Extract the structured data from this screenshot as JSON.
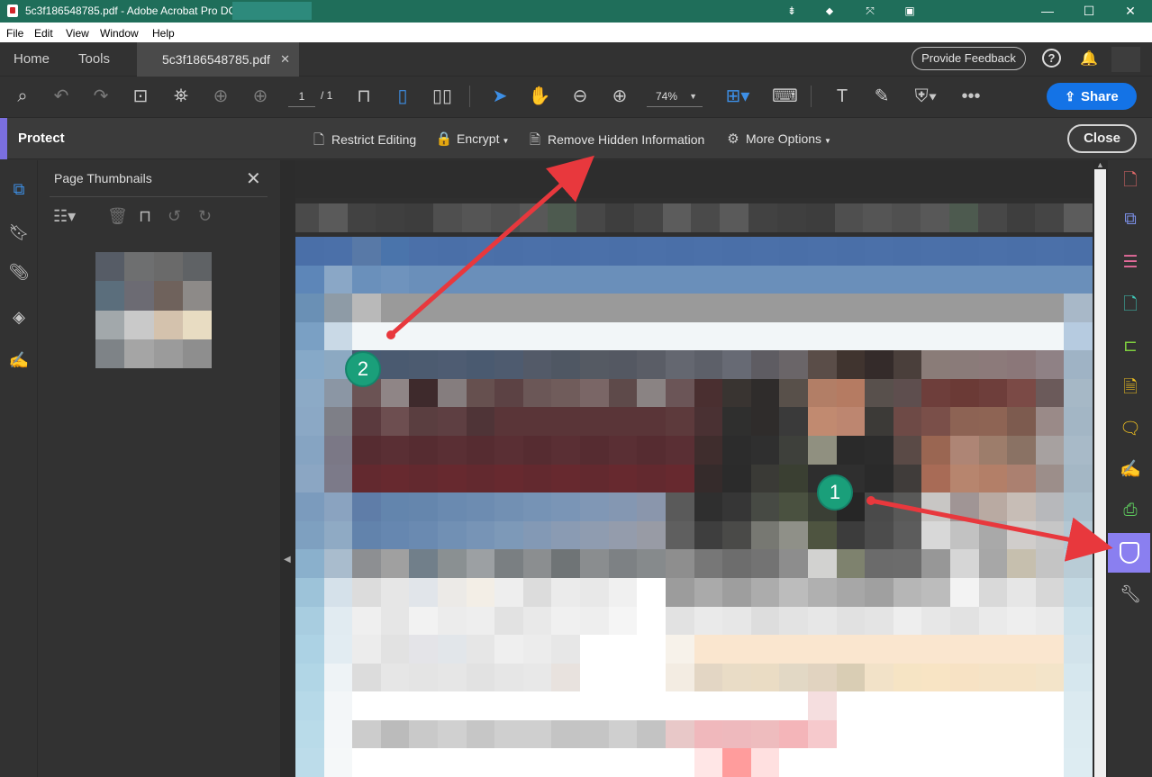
{
  "window": {
    "title": "5c3f186548785.pdf - Adobe Acrobat Pro DC"
  },
  "menu": [
    "File",
    "Edit",
    "View",
    "Window",
    "Help"
  ],
  "tabs": {
    "home": "Home",
    "tools": "Tools",
    "document": "5c3f186548785.pdf"
  },
  "header": {
    "feedback": "Provide Feedback",
    "help": "?"
  },
  "toolbar": {
    "page_current": "1",
    "page_total": "/ 1",
    "zoom": "74%",
    "share": "Share"
  },
  "protect": {
    "title": "Protect",
    "restrict": "Restrict Editing",
    "encrypt": "Encrypt",
    "remove_hidden": "Remove Hidden Information",
    "more_options": "More Options",
    "close": "Close"
  },
  "thumbnails": {
    "title": "Page Thumbnails"
  },
  "annotations": {
    "badge1": "1",
    "badge2": "2"
  },
  "colors": {
    "accent": "#1473e6",
    "protect": "#8a7ff0",
    "titlebar": "#1f6e5a",
    "arrow": "#e8383d",
    "badge": "#1a9f7a"
  }
}
